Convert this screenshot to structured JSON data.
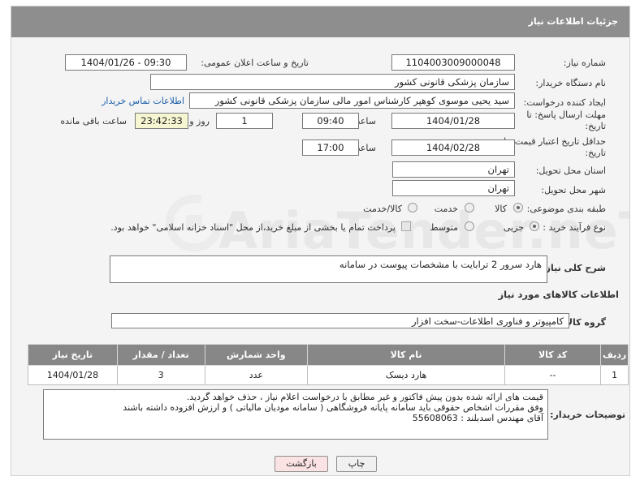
{
  "header": {
    "title": "جزئیات اطلاعات نیاز"
  },
  "form": {
    "need_number_label": "شماره نیاز:",
    "need_number": "1104003009000048",
    "announce_label": "تاریخ و ساعت اعلان عمومی:",
    "announce_value": "1404/01/26 - 09:30",
    "buyer_org_label": "نام دستگاه خریدار:",
    "buyer_org": "سازمان پزشکی قانونی کشور",
    "creator_label": "ایجاد کننده درخواست:",
    "creator": "سید یحیی موسوی کوهپر کارشناس امور مالی سازمان پزشکی قانونی کشور",
    "contact_link": "اطلاعات تماس خریدار",
    "reply_deadline_label": "مهلت ارسال پاسخ: تا تاریخ:",
    "reply_date": "1404/01/28",
    "time_label": "ساعت",
    "reply_time": "09:40",
    "days_value": "1",
    "days_label": "روز و",
    "remaining_time": "23:42:33",
    "remaining_label": "ساعت باقی مانده",
    "price_validity_label": "حداقل تاریخ اعتبار قیمت: تا تاریخ:",
    "price_date": "1404/02/28",
    "price_time": "17:00",
    "province_label": "استان محل تحویل:",
    "province": "تهران",
    "city_label": "شهر محل تحویل:",
    "city": "تهران",
    "category_label": "طبقه بندی موضوعی:",
    "category_options": [
      "کالا",
      "خدمت",
      "کالا/خدمت"
    ],
    "process_label": "نوع فرآیند خرید :",
    "process_options": [
      "جزیی",
      "متوسط"
    ],
    "payment_note": "پرداخت تمام یا بخشی از مبلغ خرید،از محل \"اسناد خزانه اسلامی\" خواهد بود."
  },
  "summary": {
    "label": "شرح کلی نیاز:",
    "text": "هارد سرور 2 ترابایت   با مشخصات پیوست در سامانه"
  },
  "goods": {
    "section_title": "اطلاعات کالاهای مورد نیاز",
    "group_label": "گروه کالا:",
    "group_value": "کامپیوتر و فناوری اطلاعات-سخت افزار",
    "columns": [
      "ردیف",
      "کد کالا",
      "نام کالا",
      "واحد شمارش",
      "تعداد / مقدار",
      "تاریخ نیاز"
    ],
    "rows": [
      {
        "row": "1",
        "code": "--",
        "name": "هارد دیسک",
        "unit": "عدد",
        "qty": "3",
        "date": "1404/01/28"
      }
    ]
  },
  "buyer_notes": {
    "label": "توضیحات خریدار:",
    "lines": [
      "قیمت های ارائه شده بدون پیش فاکتور  و غیر مطابق با درخواست اعلام نیاز  ، حذف خواهد گردید.",
      "وفق مقررات اشخاص حقوقی باید سامانه پایانه فروشگاهی ( سامانه مودیان مالیاتی ) و ارزش افزوده  داشته باشند",
      "آقای مهندس اسدبلند :        55608063"
    ]
  },
  "buttons": {
    "print": "چاپ",
    "back": "بازگشت"
  },
  "watermark": {
    "text": "AriaTender.neT"
  }
}
